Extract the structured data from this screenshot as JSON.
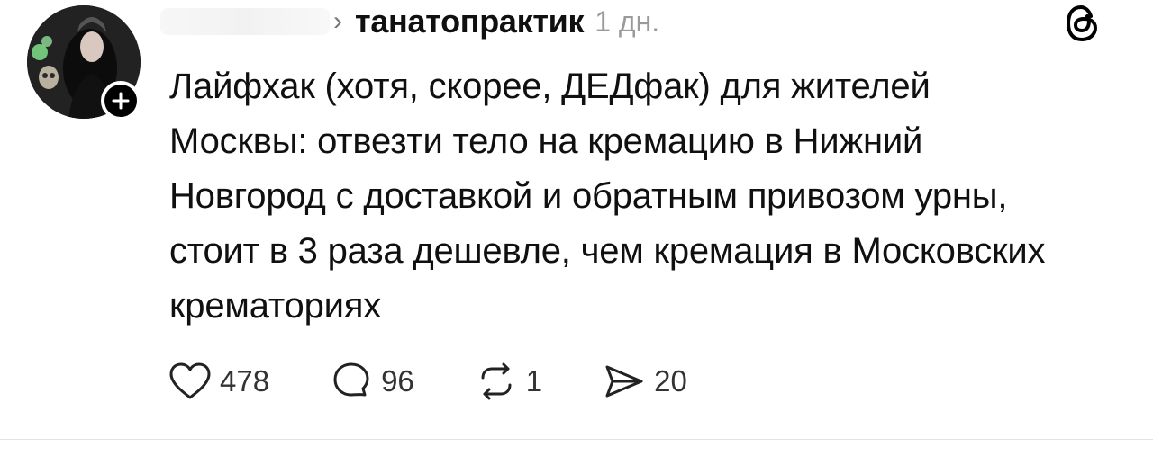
{
  "post": {
    "author": {
      "username": "танатопрактик",
      "avatar_alt": "avatar",
      "follow_icon": "plus-icon"
    },
    "timestamp": "1 дн.",
    "text": "Лайфхак (хотя, скорее, ДЕДфак) для жителей Москвы: отвезти тело на кремацию в Нижний Новгород с доставкой и обратным привозом урны, стоит в 3 раза дешевле, чем кремация в Московских крематориях",
    "actions": {
      "likes": "478",
      "comments": "96",
      "reposts": "1",
      "shares": "20"
    }
  },
  "icons": {
    "like": "heart-icon",
    "comment": "comment-bubble-icon",
    "repost": "repost-icon",
    "share": "send-icon",
    "app": "threads-logo-icon",
    "chevron": "chevron-right-icon"
  }
}
